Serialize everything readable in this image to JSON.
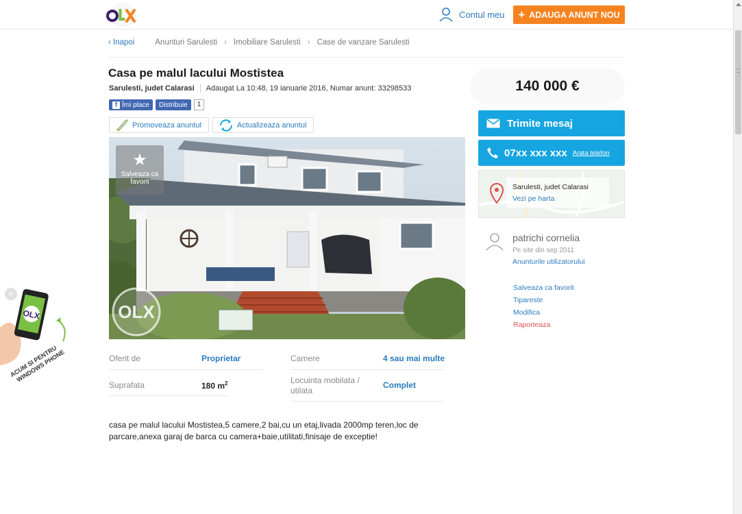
{
  "header": {
    "logo": "OLX",
    "account_label": "Contul meu",
    "add_button_label": "ADAUGA ANUNT NOU",
    "add_button_icon": "plus-icon"
  },
  "breadcrumb": {
    "back_label": "Inapoi",
    "items": [
      "Anunturi Sarulesti",
      "Imobiliare Sarulesti",
      "Case de vanzare Sarulesti"
    ]
  },
  "listing": {
    "title": "Casa pe malul lacului Mostistea",
    "location": "Sarulesti, judet Calarasi",
    "added_info": "Adaugat La 10:48, 19 ianuarie 2016, Numar anunt: 33298533",
    "like_label": "Îmi place",
    "share_label": "Distribuie",
    "share_count": "1",
    "promote_label": "Promoveaza anuntul",
    "update_label": "Actualizeaza anuntul",
    "photo": {
      "favorite_label": "Salveaza ca favorit",
      "watermark": "OLX"
    },
    "details": [
      {
        "label": "Oferit de",
        "value": "Proprietar"
      },
      {
        "label": "Camere",
        "value": "4 sau mai multe"
      },
      {
        "label": "Suprafata",
        "value": "180 m",
        "unit_sup": "2"
      },
      {
        "label": "Locuinta mobilata / utilata",
        "value": "Complet"
      }
    ],
    "description": "casa pe malul lacului Mostistea,5 camere,2 bai,cu un etaj,livada 2000mp teren,loc de parcare,anexa garaj de barca cu camera+baie,utilitati,finisaje de exceptie!"
  },
  "sidebar": {
    "price": "140 000 €",
    "message_button": "Trimite mesaj",
    "phone_number": "07xx xxx xxx",
    "phone_reveal": "Arata telefon",
    "map_location": "Sarulesti, judet Calarasi",
    "map_link": "Vezi pe harta",
    "user_name": "patrichi cornelia",
    "user_since": "Pe site din sep 2011",
    "user_ads_link": "Anunturile utilizatorului",
    "links": [
      "Salveaza ca favorit",
      "Tipareste",
      "Modifica",
      "Raporteaza"
    ]
  },
  "promo": {
    "text_line1": "ACUM SI PENTRU",
    "text_line2": "WINDOWS PHONE",
    "phone_logo": "OLX"
  },
  "colors": {
    "accent_blue": "#16a5e0",
    "link_blue": "#2a7bbf",
    "orange": "#f5831f",
    "report_red": "#d9534f"
  }
}
